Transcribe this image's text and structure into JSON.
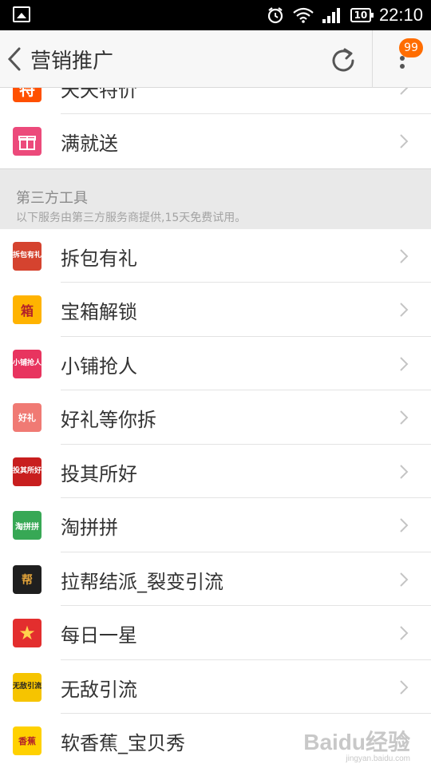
{
  "status_bar": {
    "time": "22:10",
    "battery": "10"
  },
  "header": {
    "title": "营销推广",
    "badge": "99"
  },
  "top_items": [
    {
      "label": "天天特价",
      "icon": "tiantian-tejia-icon",
      "icon_text": "特",
      "color": "#ff5000"
    },
    {
      "label": "满就送",
      "icon": "gift-box-icon",
      "color": "#ec4a7b"
    }
  ],
  "section": {
    "title": "第三方工具",
    "subtitle": "以下服务由第三方服务商提供,15天免费试用。"
  },
  "items": [
    {
      "label": "拆包有礼",
      "icon": "chaibao-youli-icon",
      "icon_text": "拆包有礼",
      "color": "#d5432f"
    },
    {
      "label": "宝箱解锁",
      "icon": "treasure-box-icon",
      "icon_text": "箱",
      "color": "#ffb300"
    },
    {
      "label": "小铺抢人",
      "icon": "xiaopu-qiangren-icon",
      "icon_text": "小铺抢人",
      "color": "#e8345f"
    },
    {
      "label": "好礼等你拆",
      "icon": "haoli-icon",
      "icon_text": "好礼",
      "color": "#f07a74"
    },
    {
      "label": "投其所好",
      "icon": "touqi-suohao-icon",
      "icon_text": "投其所好",
      "color": "#c81e1e"
    },
    {
      "label": "淘拼拼",
      "icon": "taopinpin-icon",
      "icon_text": "淘拼拼",
      "color": "#37a855"
    },
    {
      "label": "拉帮结派_裂变引流",
      "icon": "labang-jiepai-icon",
      "icon_text": "帮",
      "color": "#1f1f1f"
    },
    {
      "label": "每日一星",
      "icon": "star-icon",
      "icon_text": "★",
      "color": "#e32e2e"
    },
    {
      "label": "无敌引流",
      "icon": "wudi-yinliu-icon",
      "icon_text": "无敌引流",
      "color": "#f6c400"
    },
    {
      "label": "软香蕉_宝贝秀",
      "icon": "banana-icon",
      "icon_text": "香蕉",
      "color": "#ffd100"
    }
  ],
  "watermark": {
    "brand": "Baidu经验",
    "url": "jingyan.baidu.com"
  }
}
